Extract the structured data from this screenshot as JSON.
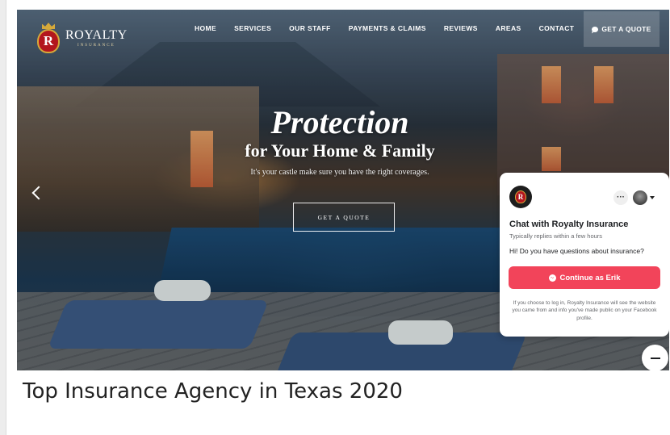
{
  "brand": {
    "logo_letter": "R",
    "name": "ROYALTY",
    "tagline": "INSURANCE",
    "colors": {
      "crest_red": "#b3161d",
      "gold": "#d6a93a"
    }
  },
  "nav": {
    "items": [
      {
        "label": "HOME"
      },
      {
        "label": "SERVICES"
      },
      {
        "label": "OUR STAFF"
      },
      {
        "label": "PAYMENTS & CLAIMS"
      },
      {
        "label": "REVIEWS"
      },
      {
        "label": "AREAS"
      },
      {
        "label": "CONTACT"
      }
    ],
    "quote_button": {
      "label": "GET A QUOTE",
      "icon": "chat-bubble-icon"
    }
  },
  "hero": {
    "headline": "Protection",
    "subheadline": "for Your Home & Family",
    "tagline": "It's your castle make sure you have the right coverages.",
    "cta_label": "GET A QUOTE",
    "prev_icon": "chevron-left-icon"
  },
  "chat": {
    "title": "Chat with Royalty Insurance",
    "status": "Typically replies within a few hours",
    "greeting": "Hi! Do you have questions about insurance?",
    "more_glyph": "···",
    "continue_label": "Continue as Erik",
    "disclaimer": "If you choose to log in, Royalty Insurance will see the website you came from and info you've made public on your Facebook profile.",
    "accent_color": "#f2445a"
  },
  "caption": "Top Insurance Agency in Texas 2020"
}
